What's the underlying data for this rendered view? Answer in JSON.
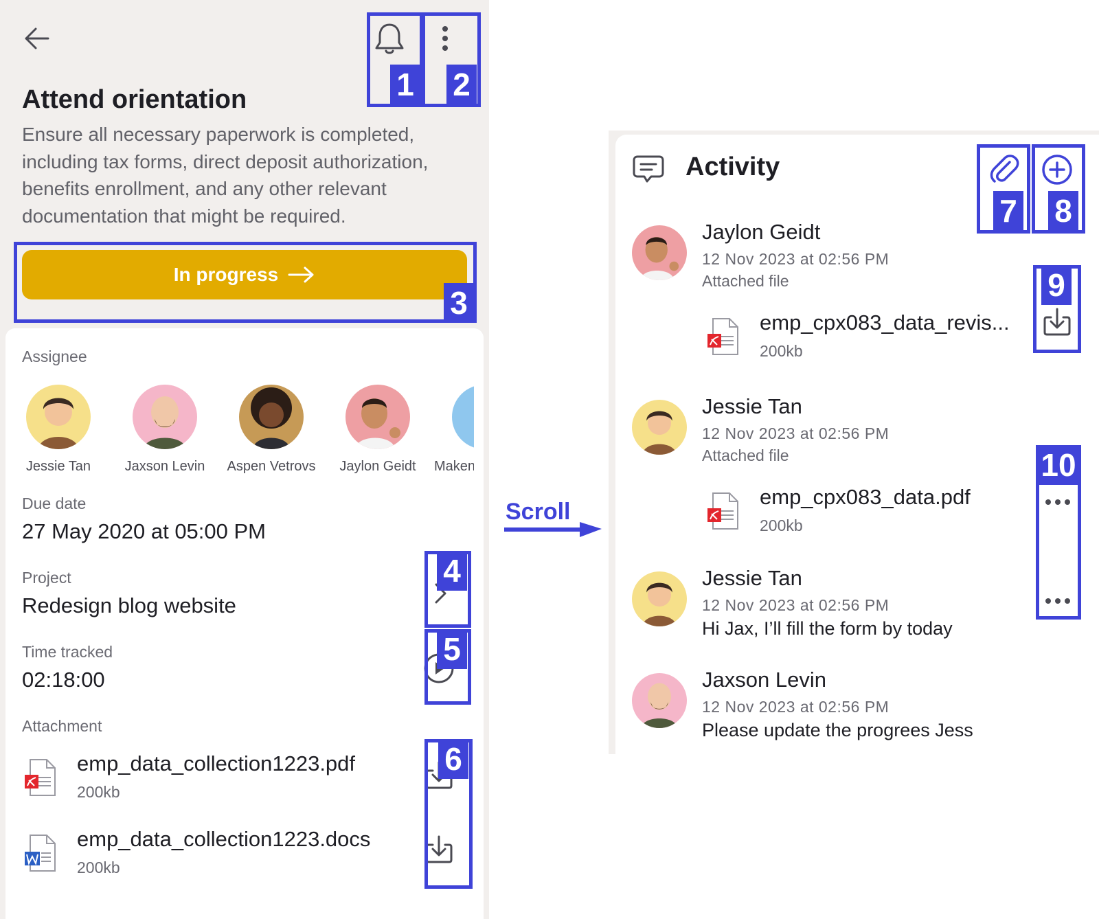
{
  "task": {
    "title": "Attend orientation",
    "description": "Ensure all necessary paperwork is completed, including tax forms, direct deposit authorization, benefits enrollment, and any other relevant documentation that might be required.",
    "status_label": "In progress"
  },
  "details": {
    "assignee_label": "Assignee",
    "assignees": [
      {
        "name": "Jessie Tan",
        "color": "#f6e08a"
      },
      {
        "name": "Jaxson Levin",
        "color": "#f5b6c9"
      },
      {
        "name": "Aspen Vetrovs",
        "color": "#c69a56"
      },
      {
        "name": "Jaylon Geidt",
        "color": "#ee9fa3"
      },
      {
        "name": "Maken",
        "color": "#8fc7ee"
      }
    ],
    "due_label": "Due date",
    "due_value": "27 May 2020 at 05:00 PM",
    "project_label": "Project",
    "project_value": "Redesign blog website",
    "time_label": "Time tracked",
    "time_value": "02:18:00",
    "attachment_label": "Attachment",
    "attachments": [
      {
        "name": "emp_data_collection1223.pdf",
        "size": "200kb",
        "type": "pdf"
      },
      {
        "name": "emp_data_collection1223.docs",
        "size": "200kb",
        "type": "word"
      }
    ]
  },
  "activity": {
    "title": "Activity",
    "items": [
      {
        "name": "Jaylon Geidt",
        "time": "12 Nov 2023 at 02:56 PM",
        "action": "Attached file",
        "file": "emp_cpx083_data_revis...",
        "size": "200kb",
        "avatar_color": "#ee9fa3"
      },
      {
        "name": "Jessie Tan",
        "time": "12 Nov 2023 at 02:56 PM",
        "action": "Attached file",
        "file": "emp_cpx083_data.pdf",
        "size": "200kb",
        "avatar_color": "#f6e08a"
      },
      {
        "name": "Jessie Tan",
        "time": "12 Nov 2023 at 02:56 PM",
        "message": "Hi Jax, I’ll fill the form by today",
        "avatar_color": "#f6e08a"
      },
      {
        "name": "Jaxson Levin",
        "time": "12 Nov 2023 at 02:56 PM",
        "message": "Please update the progrees Jess",
        "avatar_color": "#f5b6c9"
      }
    ]
  },
  "annotations": {
    "scroll_label": "Scroll",
    "tags": [
      "1",
      "2",
      "3",
      "4",
      "5",
      "6",
      "7",
      "8",
      "9",
      "10"
    ],
    "color": "#3f43d8"
  },
  "colors": {
    "accent": "#e2ab00",
    "background": "#f2efed",
    "pdf_red": "#e3262d",
    "word_blue": "#2b5fc4"
  }
}
